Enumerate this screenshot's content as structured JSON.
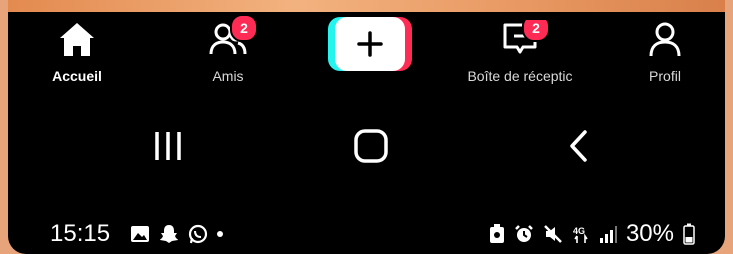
{
  "tabbar": {
    "home_label": "Accueil",
    "friends_label": "Amis",
    "friends_badge": "2",
    "create_icon": "plus-icon",
    "inbox_label": "Boîte de réceptic",
    "inbox_badge": "2",
    "profile_label": "Profil"
  },
  "navbar": {
    "recent_icon": "recent-apps-icon",
    "home_icon": "home-nav-icon",
    "back_icon": "back-icon"
  },
  "status": {
    "time": "15:15",
    "battery_percent": "30%"
  },
  "colors": {
    "accent_red": "#fe2c55",
    "accent_cyan": "#25f4ee",
    "background": "#000000"
  }
}
